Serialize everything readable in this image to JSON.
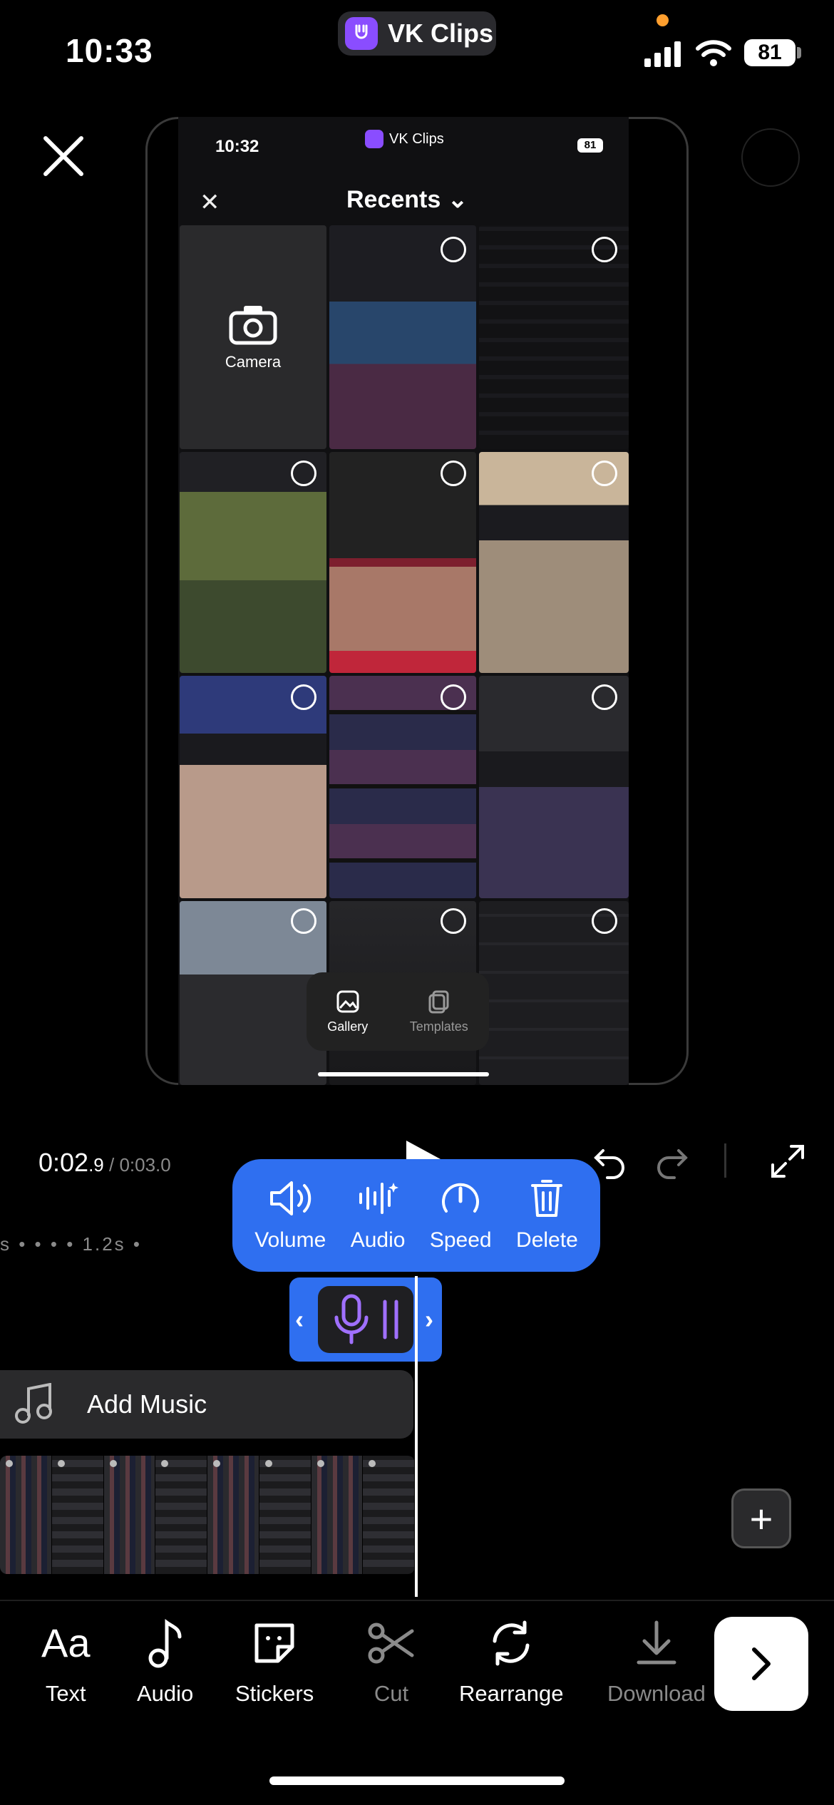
{
  "status_bar": {
    "time": "10:33",
    "app_name": "VK Clips",
    "battery": "81"
  },
  "preview": {
    "status_time": "10:32",
    "app_name": "VK Clips",
    "battery": "81",
    "title": "Recents",
    "camera_label": "Camera",
    "gallery_label": "Gallery",
    "templates_label": "Templates"
  },
  "timeline": {
    "current_time": "0:02",
    "current_frac": ".9",
    "separator": " / ",
    "total_time": "0:03",
    "total_frac": ".0",
    "ruler_text": "s  •  •  •  • 1.2s  •"
  },
  "clip_actions": [
    {
      "label": "Volume",
      "icon": "volume-icon"
    },
    {
      "label": "Audio",
      "icon": "audio-wave-icon"
    },
    {
      "label": "Speed",
      "icon": "speed-gauge-icon"
    },
    {
      "label": "Delete",
      "icon": "trash-icon"
    }
  ],
  "add_music_label": "Add Music",
  "toolbar": [
    {
      "label": "Text",
      "icon": "text-icon"
    },
    {
      "label": "Audio",
      "icon": "music-note-icon"
    },
    {
      "label": "Stickers",
      "icon": "sticker-icon"
    },
    {
      "label": "Cut",
      "icon": "scissors-icon"
    },
    {
      "label": "Rearrange",
      "icon": "rearrange-icon"
    },
    {
      "label": "Download",
      "icon": "download-icon"
    }
  ],
  "colors": {
    "accent": "#2f6ff0",
    "voice_clip_icon": "#a070ff"
  }
}
